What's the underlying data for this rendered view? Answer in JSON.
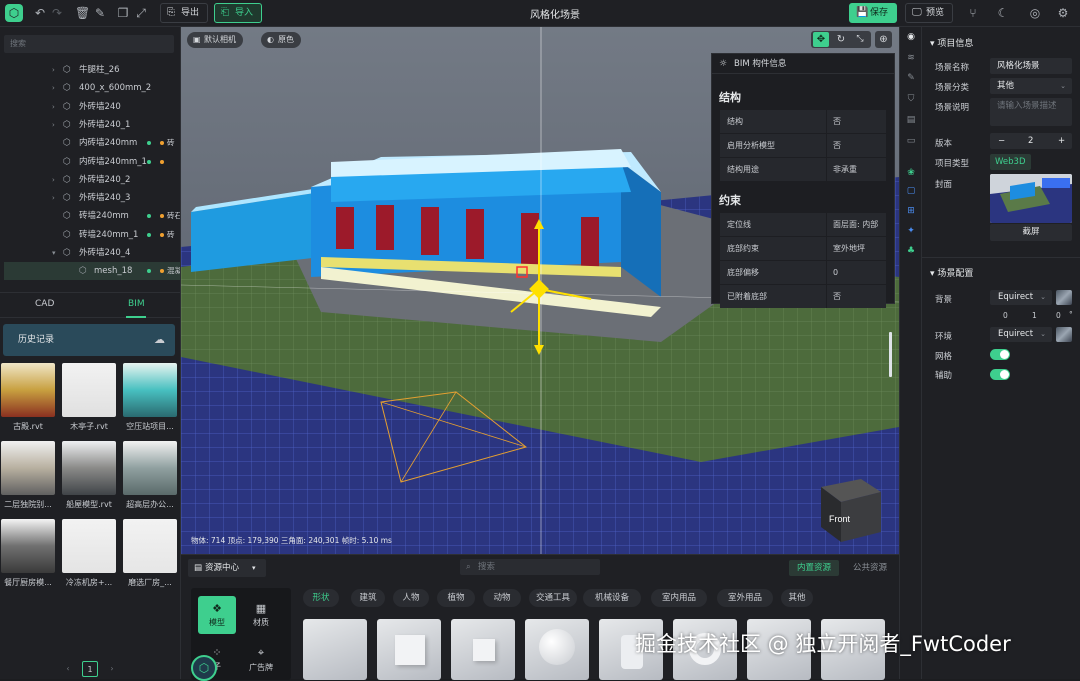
{
  "topbar": {
    "export_label": "导出",
    "import_label": "导入",
    "title": "风格化场景",
    "save_label": "保存",
    "preview_label": "预览"
  },
  "left": {
    "search_placeholder": "搜索",
    "tree": [
      {
        "label": "牛腿柱_26",
        "expandable": true,
        "dots": false
      },
      {
        "label": "400_x_600mm_2",
        "expandable": true,
        "dots": false
      },
      {
        "label": "外砖墙240",
        "expandable": true,
        "dots": false
      },
      {
        "label": "外砖墙240_1",
        "expandable": true,
        "dots": false
      },
      {
        "label": "内砖墙240mm",
        "expandable": false,
        "dots": true,
        "extra": "砖"
      },
      {
        "label": "内砖墙240mm_1",
        "expandable": false,
        "dots": true,
        "extra": ""
      },
      {
        "label": "外砖墙240_2",
        "expandable": true,
        "dots": false
      },
      {
        "label": "外砖墙240_3",
        "expandable": true,
        "dots": false
      },
      {
        "label": "砖墙240mm",
        "expandable": false,
        "dots": true,
        "extra": "砖石"
      },
      {
        "label": "砖墙240mm_1",
        "expandable": false,
        "dots": true,
        "extra": "砖"
      },
      {
        "label": "外砖墙240_4",
        "expandable": true,
        "dots": false,
        "open": true
      },
      {
        "label": "mesh_18",
        "expandable": false,
        "dots": true,
        "extra": "混凝",
        "selected": true
      }
    ],
    "tab_cad": "CAD",
    "tab_bim": "BIM",
    "history_label": "历史记录",
    "assets": [
      {
        "name": "古殿.rvt"
      },
      {
        "name": "木亭子.rvt"
      },
      {
        "name": "空压站项目..."
      },
      {
        "name": "二层独院别..."
      },
      {
        "name": "船屋模型.rvt"
      },
      {
        "name": "超高层办公..."
      },
      {
        "name": "餐厅厨房模..."
      },
      {
        "name": "冷冻机房+..."
      },
      {
        "name": "磨选厂房_..."
      }
    ],
    "page": "1"
  },
  "viewport": {
    "camera_label": "默认相机",
    "color_label": "原色",
    "stats": "物体: 714  顶点: 179,390  三角面: 240,301  帧时: 5.10 ms",
    "cube_label": "Front"
  },
  "bim": {
    "header": "BIM 构件信息",
    "sec1": "结构",
    "sec2": "约束",
    "rows1": [
      {
        "k": "结构",
        "v": "否"
      },
      {
        "k": "启用分析模型",
        "v": "否"
      },
      {
        "k": "结构用途",
        "v": "非承重"
      }
    ],
    "rows2": [
      {
        "k": "定位线",
        "v": "面层面: 内部"
      },
      {
        "k": "底部约束",
        "v": "室外地坪"
      },
      {
        "k": "底部偏移",
        "v": "0"
      },
      {
        "k": "已附着底部",
        "v": "否"
      }
    ]
  },
  "right": {
    "project_header": "项目信息",
    "scene_name_label": "场景名称",
    "scene_name": "风格化场景",
    "scene_cat_label": "场景分类",
    "scene_cat": "其他",
    "scene_desc_label": "场景说明",
    "scene_desc_ph": "请输入场景描述",
    "version_label": "版本",
    "version": "2",
    "project_type_label": "项目类型",
    "project_type": "Web3D",
    "cover_label": "封面",
    "capture_label": "截屏",
    "scene_cfg_header": "场景配置",
    "bg_label": "背景",
    "bg_value": "Equirect",
    "rot_x": "0",
    "rot_y": "1",
    "rot_z": "0",
    "deg": "°",
    "env_label": "环境",
    "env_value": "Equirect",
    "grid_label": "网格",
    "aux_label": "辅助"
  },
  "bottom": {
    "resource_label": "资源中心",
    "search_placeholder": "搜索",
    "inner_label": "内置资源",
    "public_label": "公共资源",
    "cat_model": "模型",
    "cat_material": "材质",
    "cat_billboard": "广告牌",
    "cat_particle": "子",
    "chips": [
      "形状",
      "建筑",
      "人物",
      "植物",
      "动物",
      "交通工具",
      "机械设备",
      "室内用品",
      "室外用品",
      "其他"
    ]
  },
  "watermark": "掘金技术社区 @ 独立开阅者_FwtCoder"
}
